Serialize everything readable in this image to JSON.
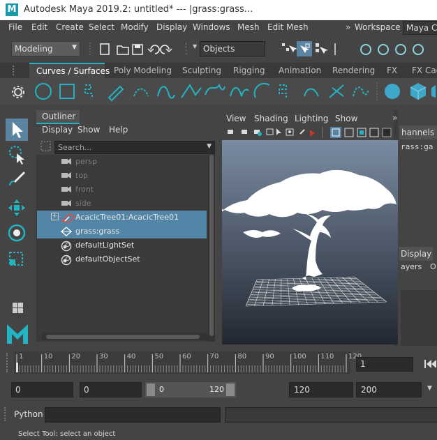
{
  "window": {
    "logo_letter": "M",
    "title": "Autodesk Maya 2019.2: untitled*    ---    |grass:grass..."
  },
  "menu": {
    "items": [
      "File",
      "Edit",
      "Create",
      "Select",
      "Modify",
      "Display",
      "Windows",
      "Mesh",
      "Edit Mesh"
    ],
    "workspace_label": "Workspace :",
    "workspace_value": "Maya Cla"
  },
  "status_line": {
    "mode": "Modeling",
    "selection_mask": "Objects"
  },
  "shelf": {
    "tabs": [
      "Curves / Surfaces",
      "Poly Modeling",
      "Sculpting",
      "Rigging",
      "Animation",
      "Rendering",
      "FX",
      "FX Cach"
    ],
    "active_tab": "Curves / Surfaces"
  },
  "outliner": {
    "title": "Outliner",
    "menu": [
      "Display",
      "Show",
      "Help"
    ],
    "search_placeholder": "Search...",
    "items": [
      {
        "label": "persp",
        "icon": "camera-icon",
        "dim": true,
        "selected": false
      },
      {
        "label": "top",
        "icon": "camera-icon",
        "dim": true,
        "selected": false
      },
      {
        "label": "front",
        "icon": "camera-icon",
        "dim": true,
        "selected": false
      },
      {
        "label": "side",
        "icon": "camera-icon",
        "dim": true,
        "selected": false
      },
      {
        "label": "AcacicTree01:AcacicTree01",
        "icon": "mesh-icon",
        "dim": false,
        "selected": true
      },
      {
        "label": "grass:grass",
        "icon": "grass-icon",
        "dim": false,
        "selected": true
      },
      {
        "label": "defaultLightSet",
        "icon": "set-icon",
        "dim": false,
        "selected": false
      },
      {
        "label": "defaultObjectSet",
        "icon": "set-icon",
        "dim": false,
        "selected": false
      }
    ]
  },
  "viewport": {
    "menu": [
      "View",
      "Shading",
      "Lighting",
      "Show"
    ],
    "top_color": "#7a8ba2",
    "bottom_color": "#222831"
  },
  "channel_box": {
    "tab_label": "hannels",
    "object_name": "rass:ga",
    "tabs": [
      "Display",
      "ayers",
      "O"
    ]
  },
  "time_slider": {
    "ticks": [
      "1",
      "10",
      "20",
      "30",
      "40",
      "50",
      "60",
      "70",
      "80",
      "90",
      "100",
      "110",
      "120"
    ],
    "current_frame": "1"
  },
  "range_slider": {
    "start": "0",
    "anim_start": "0",
    "range_min": "0",
    "range_max": "120",
    "anim_end": "120",
    "end": "200"
  },
  "command_line": {
    "label": "Python"
  },
  "help_line": {
    "text": "Select Tool: select an object"
  },
  "colors": {
    "accent": "#21b5c4",
    "selection": "#5285a6"
  }
}
